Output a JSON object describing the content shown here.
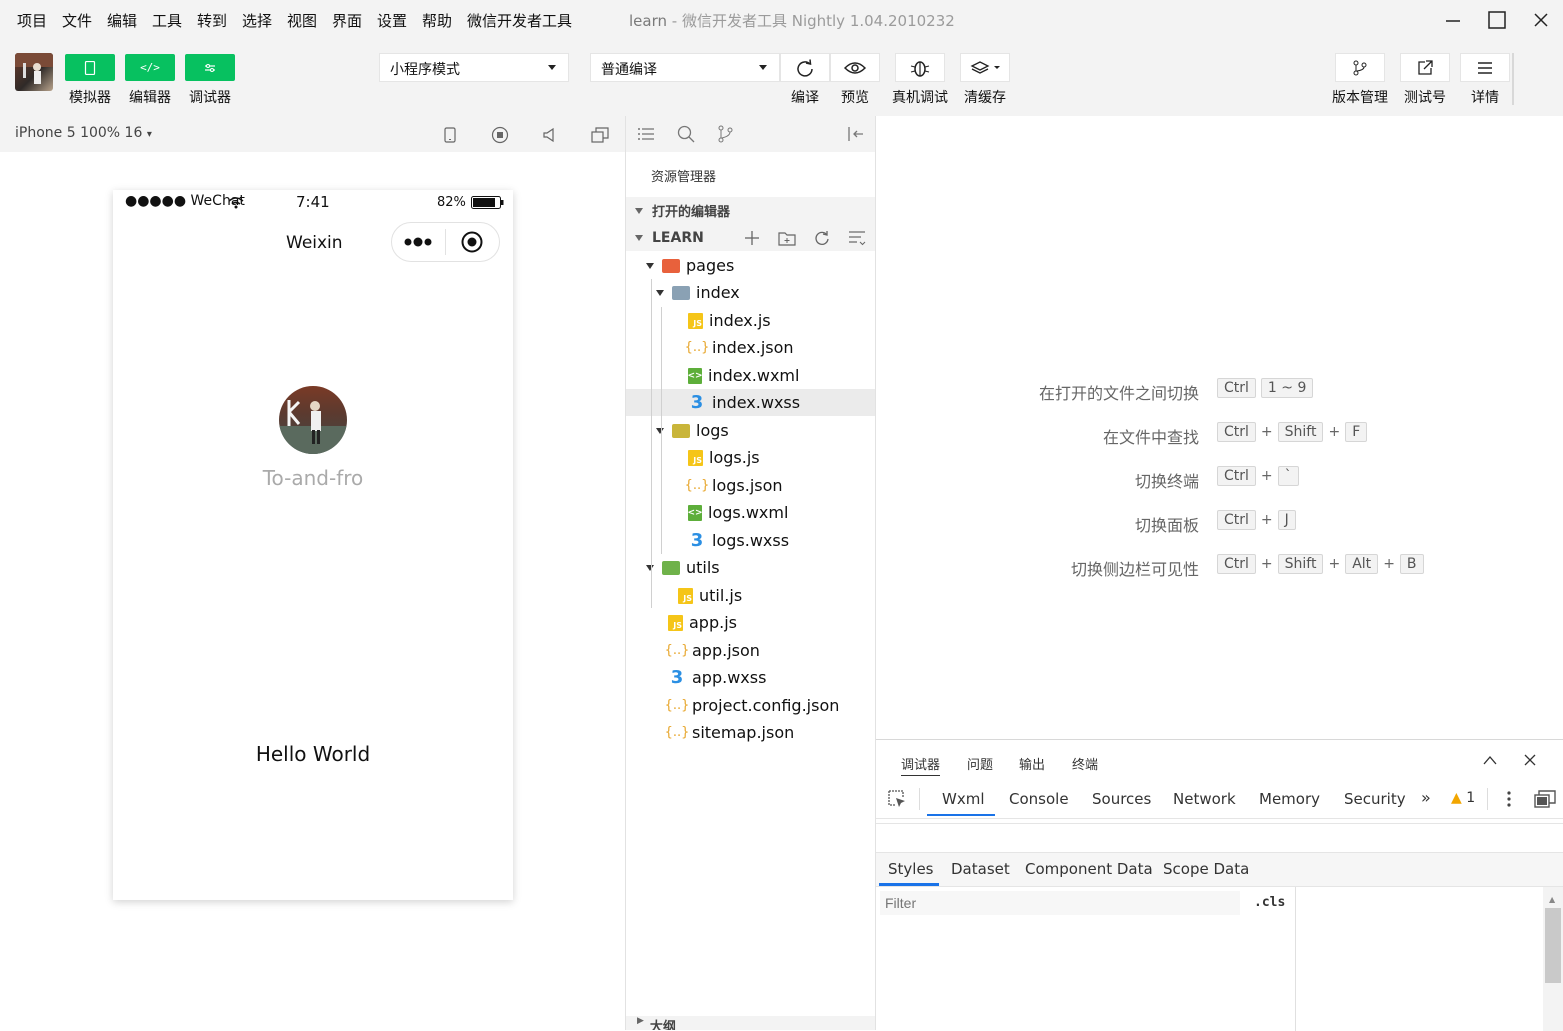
{
  "menu": [
    "项目",
    "文件",
    "编辑",
    "工具",
    "转到",
    "选择",
    "视图",
    "界面",
    "设置",
    "帮助",
    "微信开发者工具"
  ],
  "window": {
    "title": "learn",
    "subtitle": " - 微信开发者工具 Nightly 1.04.2010232"
  },
  "toolbar": {
    "simulator_label": "模拟器",
    "editor_label": "编辑器",
    "debugger_label": "调试器",
    "mode_select": "小程序模式",
    "compile_select": "普通编译",
    "compile_label": "编译",
    "preview_label": "预览",
    "realdebug_label": "真机调试",
    "clearcache_label": "清缓存",
    "version_label": "版本管理",
    "testno_label": "测试号",
    "details_label": "详情"
  },
  "simulator": {
    "device": "iPhone 5 100% 16",
    "status": {
      "carrier": "●●●●● WeChat",
      "time": "7:41",
      "battery": "82%"
    },
    "nav_title": "Weixin",
    "username": "To-and-fro",
    "motto": "Hello World"
  },
  "explorer": {
    "title": "资源管理器",
    "open_editors": "打开的编辑器",
    "project": "LEARN",
    "outline": "大纲",
    "tree": [
      {
        "name": "pages",
        "type": "folder",
        "depth": 0,
        "color": "#e8613c"
      },
      {
        "name": "index",
        "type": "folder",
        "depth": 1,
        "color": "#8aa1b4"
      },
      {
        "name": "index.js",
        "type": "js",
        "depth": 2
      },
      {
        "name": "index.json",
        "type": "json",
        "depth": 2
      },
      {
        "name": "index.wxml",
        "type": "wxml",
        "depth": 2
      },
      {
        "name": "index.wxss",
        "type": "wxss",
        "depth": 2,
        "selected": true
      },
      {
        "name": "logs",
        "type": "folder",
        "depth": 1,
        "color": "#c9b53a"
      },
      {
        "name": "logs.js",
        "type": "js",
        "depth": 2
      },
      {
        "name": "logs.json",
        "type": "json",
        "depth": 2
      },
      {
        "name": "logs.wxml",
        "type": "wxml",
        "depth": 2
      },
      {
        "name": "logs.wxss",
        "type": "wxss",
        "depth": 2
      },
      {
        "name": "utils",
        "type": "folder",
        "depth": 0,
        "color": "#6fb24a"
      },
      {
        "name": "util.js",
        "type": "js",
        "depth": 1
      },
      {
        "name": "app.js",
        "type": "js",
        "depth": 0
      },
      {
        "name": "app.json",
        "type": "json",
        "depth": 0
      },
      {
        "name": "app.wxss",
        "type": "wxss",
        "depth": 0
      },
      {
        "name": "project.config.json",
        "type": "json",
        "depth": 0
      },
      {
        "name": "sitemap.json",
        "type": "json",
        "depth": 0
      }
    ]
  },
  "shortcuts": [
    {
      "label": "在打开的文件之间切换",
      "keys": [
        "Ctrl",
        "1 ~ 9"
      ]
    },
    {
      "label": "在文件中查找",
      "keys": [
        "Ctrl",
        "+",
        "Shift",
        "+",
        "F"
      ]
    },
    {
      "label": "切换终端",
      "keys": [
        "Ctrl",
        "+",
        "`"
      ]
    },
    {
      "label": "切换面板",
      "keys": [
        "Ctrl",
        "+",
        "J"
      ]
    },
    {
      "label": "切换侧边栏可见性",
      "keys": [
        "Ctrl",
        "+",
        "Shift",
        "+",
        "Alt",
        "+",
        "B"
      ]
    }
  ],
  "devtools": {
    "top_tabs": [
      "调试器",
      "问题",
      "输出",
      "终端"
    ],
    "panels": [
      "Wxml",
      "Console",
      "Sources",
      "Network",
      "Memory",
      "Security"
    ],
    "warning_count": "1",
    "sub_tabs": [
      "Styles",
      "Dataset",
      "Component Data",
      "Scope Data"
    ],
    "filter_placeholder": "Filter",
    "cls_label": ".cls"
  },
  "colors": {
    "accent": "#07c160",
    "chrome": "#f3f3f3"
  }
}
